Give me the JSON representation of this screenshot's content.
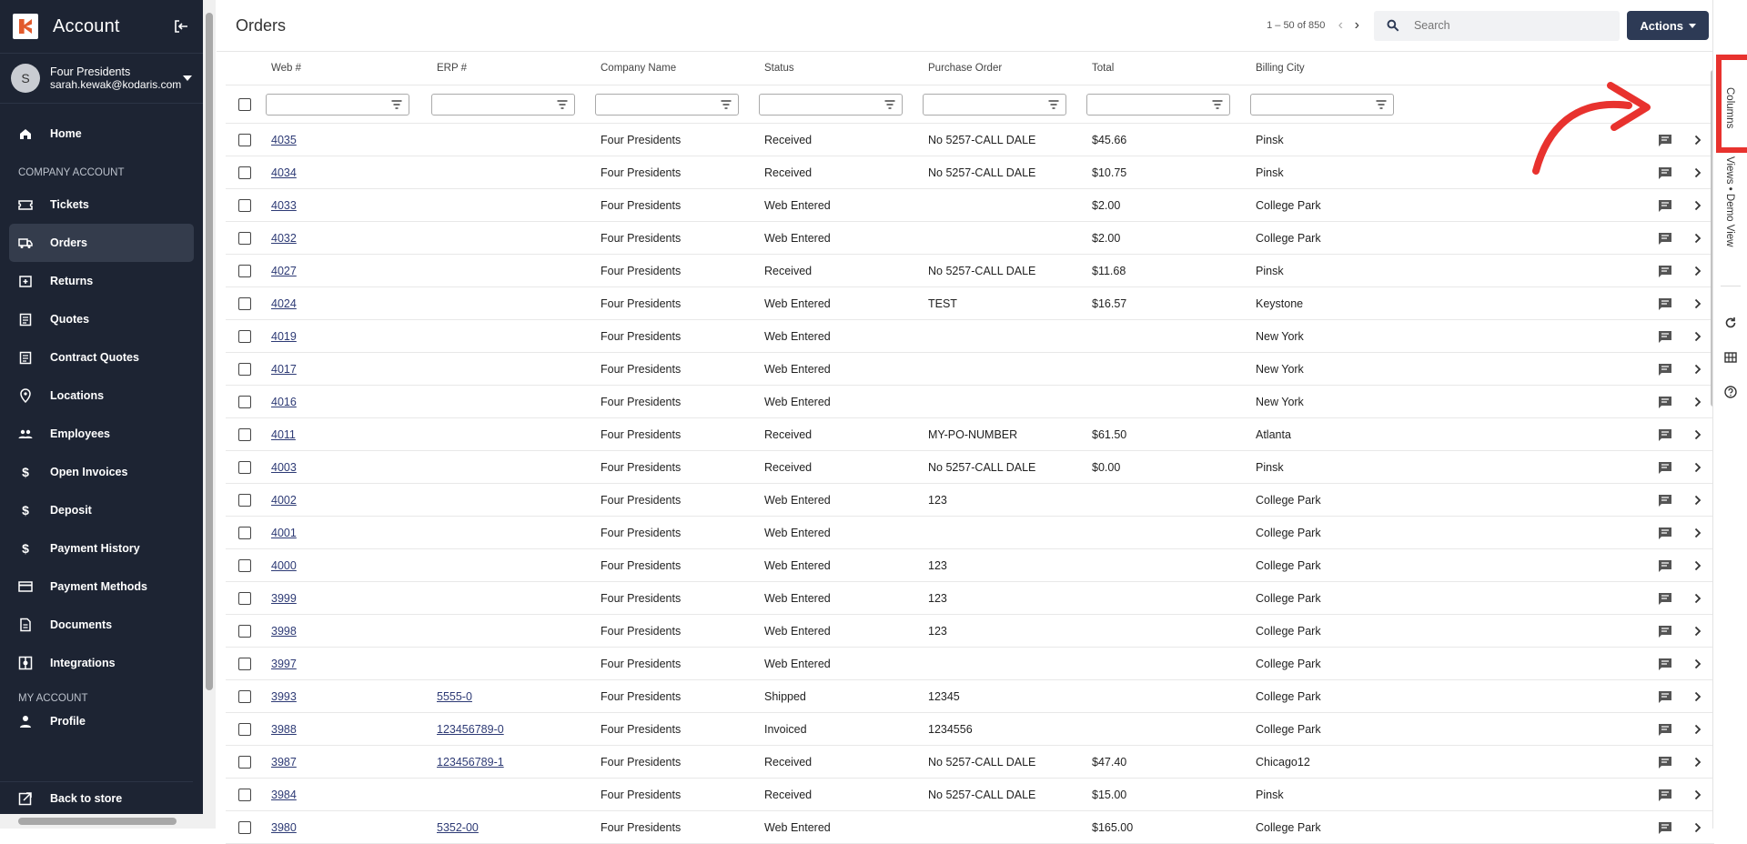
{
  "sidebar": {
    "app_title": "Account",
    "user": {
      "initial": "S",
      "name": "Four Presidents",
      "email": "sarah.kewak@kodaris.com"
    },
    "home_label": "Home",
    "company_section_label": "COMPANY ACCOUNT",
    "items": [
      {
        "label": "Tickets",
        "icon": "tickets-icon"
      },
      {
        "label": "Orders",
        "icon": "truck-icon",
        "active": true
      },
      {
        "label": "Returns",
        "icon": "return-box-icon"
      },
      {
        "label": "Quotes",
        "icon": "clipboard-icon"
      },
      {
        "label": "Contract Quotes",
        "icon": "clipboard-icon"
      },
      {
        "label": "Locations",
        "icon": "pin-icon"
      },
      {
        "label": "Employees",
        "icon": "people-icon"
      },
      {
        "label": "Open Invoices",
        "icon": "dollar-icon"
      },
      {
        "label": "Deposit",
        "icon": "dollar-icon"
      },
      {
        "label": "Payment History",
        "icon": "dollar-icon"
      },
      {
        "label": "Payment Methods",
        "icon": "card-icon"
      },
      {
        "label": "Documents",
        "icon": "document-icon"
      },
      {
        "label": "Integrations",
        "icon": "integrations-icon"
      }
    ],
    "my_account_section_label": "MY ACCOUNT",
    "profile_label": "Profile",
    "back_to_store_label": "Back to store"
  },
  "header": {
    "title": "Orders",
    "pagination": "1 – 50 of 850",
    "search_placeholder": "Search",
    "actions_label": "Actions"
  },
  "table": {
    "columns": [
      "Web #",
      "ERP #",
      "Company Name",
      "Status",
      "Purchase Order",
      "Total",
      "Billing City"
    ],
    "rows": [
      [
        "4035",
        "",
        "Four Presidents",
        "Received",
        "No 5257-CALL DALE",
        "$45.66",
        "Pinsk"
      ],
      [
        "4034",
        "",
        "Four Presidents",
        "Received",
        "No 5257-CALL DALE",
        "$10.75",
        "Pinsk"
      ],
      [
        "4033",
        "",
        "Four Presidents",
        "Web Entered",
        "",
        "$2.00",
        "College Park"
      ],
      [
        "4032",
        "",
        "Four Presidents",
        "Web Entered",
        "",
        "$2.00",
        "College Park"
      ],
      [
        "4027",
        "",
        "Four Presidents",
        "Received",
        "No 5257-CALL DALE",
        "$11.68",
        "Pinsk"
      ],
      [
        "4024",
        "",
        "Four Presidents",
        "Web Entered",
        "TEST",
        "$16.57",
        "Keystone"
      ],
      [
        "4019",
        "",
        "Four Presidents",
        "Web Entered",
        "",
        "",
        "New York"
      ],
      [
        "4017",
        "",
        "Four Presidents",
        "Web Entered",
        "",
        "",
        "New York"
      ],
      [
        "4016",
        "",
        "Four Presidents",
        "Web Entered",
        "",
        "",
        "New York"
      ],
      [
        "4011",
        "",
        "Four Presidents",
        "Received",
        "MY-PO-NUMBER",
        "$61.50",
        "Atlanta"
      ],
      [
        "4003",
        "",
        "Four Presidents",
        "Received",
        "No 5257-CALL DALE",
        "$0.00",
        "Pinsk"
      ],
      [
        "4002",
        "",
        "Four Presidents",
        "Web Entered",
        "123",
        "",
        "College Park"
      ],
      [
        "4001",
        "",
        "Four Presidents",
        "Web Entered",
        "",
        "",
        "College Park"
      ],
      [
        "4000",
        "",
        "Four Presidents",
        "Web Entered",
        "123",
        "",
        "College Park"
      ],
      [
        "3999",
        "",
        "Four Presidents",
        "Web Entered",
        "123",
        "",
        "College Park"
      ],
      [
        "3998",
        "",
        "Four Presidents",
        "Web Entered",
        "123",
        "",
        "College Park"
      ],
      [
        "3997",
        "",
        "Four Presidents",
        "Web Entered",
        "",
        "",
        "College Park"
      ],
      [
        "3993",
        "5555-0",
        "Four Presidents",
        "Shipped",
        "12345",
        "",
        "College Park"
      ],
      [
        "3988",
        "123456789-0",
        "Four Presidents",
        "Invoiced",
        "1234556",
        "",
        "College Park"
      ],
      [
        "3987",
        "123456789-1",
        "Four Presidents",
        "Received",
        "No 5257-CALL DALE",
        "$47.40",
        "Chicago12"
      ],
      [
        "3984",
        "",
        "Four Presidents",
        "Received",
        "No 5257-CALL DALE",
        "$15.00",
        "Pinsk"
      ],
      [
        "3980",
        "5352-00",
        "Four Presidents",
        "Web Entered",
        "",
        "$165.00",
        "College Park"
      ]
    ]
  },
  "side_panel": {
    "columns_label": "Columns",
    "views_label": "Views • Demo View"
  },
  "colors": {
    "sidebar_bg": "#1d2433",
    "accent": "#2d3a55",
    "highlight": "#e8322e"
  }
}
